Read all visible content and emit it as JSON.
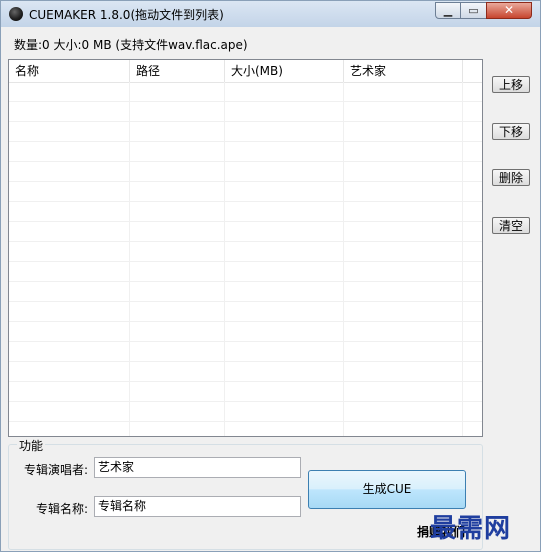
{
  "window": {
    "title": "CUEMAKER 1.8.0(拖动文件到列表)",
    "icon": "disc-icon"
  },
  "window_controls": {
    "minimize_glyph": "▁",
    "maximize_glyph": "▭",
    "close_glyph": "✕"
  },
  "status_text": "数量:0 大小:0 MB  (支持文件wav.flac.ape)",
  "file_list": {
    "columns": [
      "名称",
      "路径",
      "大小(MB)",
      "艺术家"
    ],
    "rows": []
  },
  "side_buttons": {
    "move_up": "上移",
    "move_down": "下移",
    "delete": "删除",
    "clear": "清空"
  },
  "function_group": {
    "label": "功能",
    "artist_label": "专辑演唱者:",
    "artist_value": "艺术家",
    "album_label": "专辑名称:",
    "album_value": "专辑名称",
    "generate_button": "生成CUE"
  },
  "link_text": "捐赠我们",
  "watermark": "最需网",
  "colors": {
    "watermark": "#1f3e9f",
    "close_button": "#c7452e",
    "primary_button_border": "#3c7fb1"
  }
}
